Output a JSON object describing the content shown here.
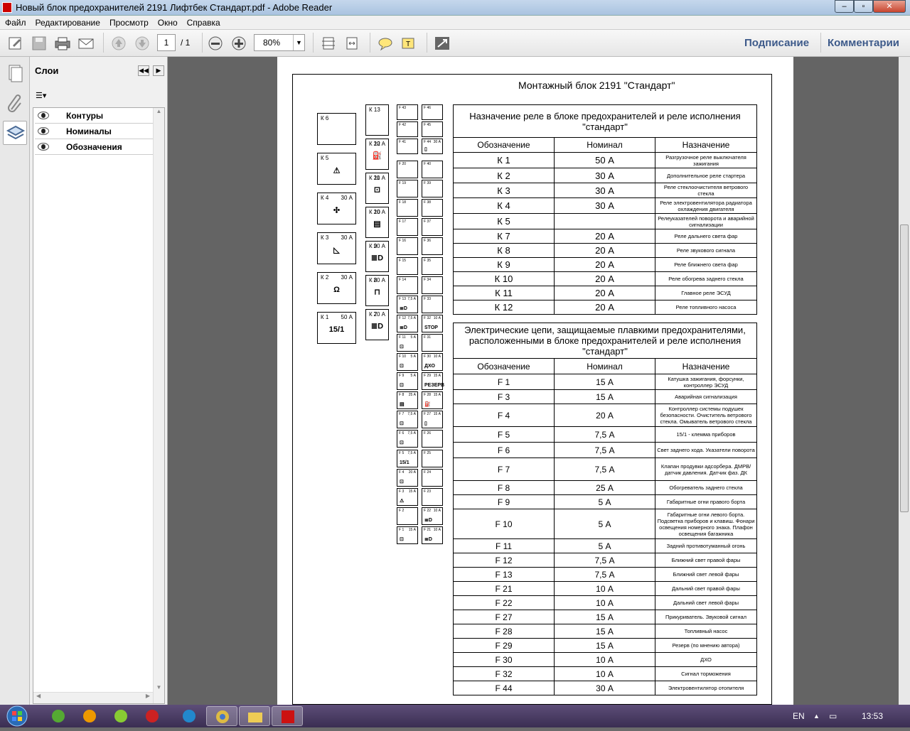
{
  "window": {
    "title": "Новый блок предохранителей 2191 Лифтбек Стандарт.pdf - Adobe Reader"
  },
  "menu": [
    "Файл",
    "Редактирование",
    "Просмотр",
    "Окно",
    "Справка"
  ],
  "toolbar": {
    "page_current": "1",
    "page_total": "/ 1",
    "zoom": "80%",
    "sign_label": "Подписание",
    "comment_label": "Комментарии"
  },
  "layers_panel": {
    "title": "Слои",
    "layers": [
      "Контуры",
      "Номиналы",
      "Обозначения"
    ]
  },
  "doc": {
    "title": "Монтажный блок 2191 \"Стандарт\"",
    "relays": [
      {
        "name": "К 6",
        "amp": "",
        "icon": ""
      },
      {
        "name": "К 5",
        "amp": "",
        "icon": "⚠"
      },
      {
        "name": "К 4",
        "amp": "30 А",
        "icon": "✣"
      },
      {
        "name": "К 3",
        "amp": "30 А",
        "icon": "◺"
      },
      {
        "name": "К 2",
        "amp": "30 А",
        "icon": "Ω"
      },
      {
        "name": "К 1",
        "amp": "50 А",
        "icon": "15/1"
      },
      {
        "name": "К 13",
        "amp": "",
        "icon": ""
      },
      {
        "name": "К 12",
        "amp": "20 А",
        "icon": "⛽"
      },
      {
        "name": "К 11",
        "amp": "20 А",
        "icon": "⊡"
      },
      {
        "name": "К 10",
        "amp": "20 А",
        "icon": "▤"
      },
      {
        "name": "К 9",
        "amp": "20 А",
        "icon": "≣D"
      },
      {
        "name": "К 8",
        "amp": "20 А",
        "icon": "⊓"
      },
      {
        "name": "К 7",
        "amp": "20 А",
        "icon": "≣D"
      }
    ],
    "fuses_left": [
      {
        "n": "F 43",
        "a": "",
        "i": ""
      },
      {
        "n": "F 42",
        "a": "",
        "i": ""
      },
      {
        "n": "F 41",
        "a": "",
        "i": ""
      },
      {
        "n": "F 20",
        "a": "",
        "i": ""
      },
      {
        "n": "F 19",
        "a": "",
        "i": ""
      },
      {
        "n": "F 18",
        "a": "",
        "i": ""
      },
      {
        "n": "F 17",
        "a": "",
        "i": ""
      },
      {
        "n": "F 16",
        "a": "",
        "i": ""
      },
      {
        "n": "F 15",
        "a": "",
        "i": ""
      },
      {
        "n": "F 14",
        "a": "",
        "i": ""
      },
      {
        "n": "F 13",
        "a": "7,5 А",
        "i": "≣D"
      },
      {
        "n": "F 12",
        "a": "7,5 А",
        "i": "≣D"
      },
      {
        "n": "F 11",
        "a": "5 А",
        "i": "⊡"
      },
      {
        "n": "F 10",
        "a": "5 А",
        "i": "⊡"
      },
      {
        "n": "F 9",
        "a": "5 А",
        "i": "⊡"
      },
      {
        "n": "F 8",
        "a": "25 А",
        "i": "▤"
      },
      {
        "n": "F 7",
        "a": "7,5 А",
        "i": "⊡"
      },
      {
        "n": "F 6",
        "a": "7,5 А",
        "i": "⊡"
      },
      {
        "n": "F 5",
        "a": "7,5 А",
        "i": "15/1"
      },
      {
        "n": "F 4",
        "a": "20 А",
        "i": "⊡"
      },
      {
        "n": "F 3",
        "a": "15 А",
        "i": "⚠"
      },
      {
        "n": "F 2",
        "a": "",
        "i": ""
      },
      {
        "n": "F 1",
        "a": "15 А",
        "i": "⊡"
      }
    ],
    "fuses_right": [
      {
        "n": "F 46",
        "a": "",
        "i": ""
      },
      {
        "n": "F 45",
        "a": "",
        "i": ""
      },
      {
        "n": "F 44",
        "a": "30 А",
        "i": "▯"
      },
      {
        "n": "F 40",
        "a": "",
        "i": ""
      },
      {
        "n": "F 39",
        "a": "",
        "i": ""
      },
      {
        "n": "F 38",
        "a": "",
        "i": ""
      },
      {
        "n": "F 37",
        "a": "",
        "i": ""
      },
      {
        "n": "F 36",
        "a": "",
        "i": ""
      },
      {
        "n": "F 35",
        "a": "",
        "i": ""
      },
      {
        "n": "F 34",
        "a": "",
        "i": ""
      },
      {
        "n": "F 33",
        "a": "",
        "i": ""
      },
      {
        "n": "F 32",
        "a": "10 А",
        "i": "STOP"
      },
      {
        "n": "F 31",
        "a": "",
        "i": ""
      },
      {
        "n": "F 30",
        "a": "10 А",
        "i": "ДХО"
      },
      {
        "n": "F 29",
        "a": "15 А",
        "i": "РЕЗЕРВ"
      },
      {
        "n": "F 28",
        "a": "15 А",
        "i": "⛽"
      },
      {
        "n": "F 27",
        "a": "15 А",
        "i": "▯"
      },
      {
        "n": "F 26",
        "a": "",
        "i": ""
      },
      {
        "n": "F 25",
        "a": "",
        "i": ""
      },
      {
        "n": "F 24",
        "a": "",
        "i": ""
      },
      {
        "n": "F 23",
        "a": "",
        "i": ""
      },
      {
        "n": "F 22",
        "a": "10 А",
        "i": "≣D"
      },
      {
        "n": "F 21",
        "a": "10 А",
        "i": "≣D"
      }
    ],
    "relay_table": {
      "caption": "Назначение реле в блоке предохранителей и реле исполнения \"стандарт\"",
      "headers": [
        "Обозначение",
        "Номинал",
        "Назначение"
      ],
      "rows": [
        [
          "К 1",
          "50 А",
          "Разгрузочное реле выключателя зажигания"
        ],
        [
          "К 2",
          "30 А",
          "Дополнительное реле стартера"
        ],
        [
          "К 3",
          "30 А",
          "Реле стеклоочистителя ветрового стекла"
        ],
        [
          "К 4",
          "30 А",
          "Реле электровентилятора радиатора охлаждения двигателя"
        ],
        [
          "К 5",
          "",
          "Релеуказателей поворота и аварийной сигнализации"
        ],
        [
          "К 7",
          "20 А",
          "Реле дальнего света фар"
        ],
        [
          "К 8",
          "20 А",
          "Реле звукового сигнала"
        ],
        [
          "К 9",
          "20 А",
          "Реле ближнего света фар"
        ],
        [
          "К 10",
          "20 А",
          "Реле обогрева заднего стекла"
        ],
        [
          "К 11",
          "20 А",
          "Главное реле ЭСУД"
        ],
        [
          "К 12",
          "20 А",
          "Реле топливного насоса"
        ]
      ]
    },
    "fuse_table": {
      "caption": "Электрические цепи, защищаемые плавкими предохранителями, расположенными в блоке предохранителей и реле исполнения \"стандарт\"",
      "headers": [
        "Обозначение",
        "Номинал",
        "Назначение"
      ],
      "rows": [
        [
          "F 1",
          "15 А",
          "Катушка зажигания, форсунки, контроллер ЭСУД"
        ],
        [
          "F 3",
          "15 А",
          "Аварийная сигнализация"
        ],
        [
          "F 4",
          "20 А",
          "Контроллер системы подушек безопасности. Очиститель ветрового стекла. Омыватель ветрового стекла"
        ],
        [
          "F 5",
          "7,5 А",
          "15/1 - клемма приборов"
        ],
        [
          "F 6",
          "7,5 А",
          "Свет заднего хода. Указатели поворота"
        ],
        [
          "F 7",
          "7,5 А",
          "Клапан продувки адсорбера. ДМРВ/датчик давления. Датчик фаз. ДК"
        ],
        [
          "F 8",
          "25 А",
          "Обогреватель заднего стекла"
        ],
        [
          "F 9",
          "5 А",
          "Габаритные огни правого борта"
        ],
        [
          "F 10",
          "5 А",
          "Габаритные огни левого борта. Подсветка приборов и клавиш. Фонари освещения номерного знака. Плафон освещения багажника"
        ],
        [
          "F 11",
          "5 А",
          "Задний противотуманный огонь"
        ],
        [
          "F 12",
          "7,5 А",
          "Ближний свет правой фары"
        ],
        [
          "F 13",
          "7,5 А",
          "Ближний свет левой фары"
        ],
        [
          "F 21",
          "10 А",
          "Дальний свет правой фары"
        ],
        [
          "F 22",
          "10 А",
          "Дальний свет левой фары"
        ],
        [
          "F 27",
          "15 А",
          "Прикуриватель. Звуковой сигнал"
        ],
        [
          "F 28",
          "15 А",
          "Топливный насос"
        ],
        [
          "F 29",
          "15 А",
          "Резерв (по мнению автора)"
        ],
        [
          "F 30",
          "10 А",
          "ДХО"
        ],
        [
          "F 32",
          "10 А",
          "Сигнал торможения"
        ],
        [
          "F 44",
          "30 А",
          "Электровентилятор отопителя"
        ]
      ]
    }
  },
  "taskbar": {
    "lang": "EN",
    "clock": "13:53"
  }
}
